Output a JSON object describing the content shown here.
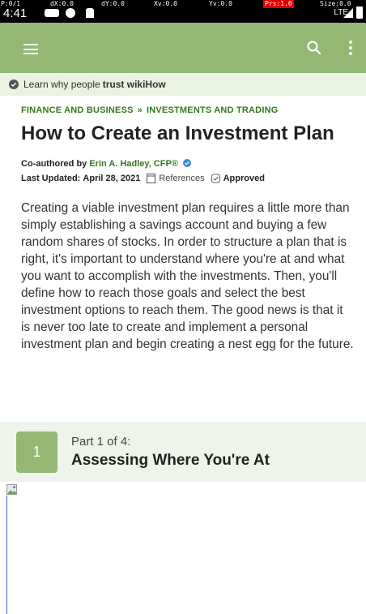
{
  "status_bar": {
    "pointer": {
      "p": "P:0/1",
      "dx": "dX:0.0",
      "dy": "dY:0.0",
      "xv": "Xv:0.0",
      "yv": "Yv:0.0",
      "prs": "Prs:1.0",
      "size": "Size:0.0"
    },
    "time": "4:41",
    "network": "LTE",
    "icons": [
      "notification-icon",
      "cellular-signal-icon",
      "battery-icon"
    ]
  },
  "app_bar": {
    "background": "#93b874",
    "icons": [
      "menu-icon",
      "search-icon",
      "more-vert-icon"
    ]
  },
  "trust_banner": {
    "prefix": "Learn why people",
    "emphasis": "trust wikiHow"
  },
  "breadcrumb": {
    "items": [
      "FINANCE AND BUSINESS",
      "INVESTMENTS AND TRADING"
    ],
    "separator": "»"
  },
  "article": {
    "title": "How to Create an Investment Plan",
    "coauthored_label": "Co-authored by",
    "author": "Erin A. Hadley, CFP®",
    "updated_label": "Last Updated:",
    "updated_date": "April 28, 2021",
    "references_label": "References",
    "approved_label": "Approved",
    "intro": "Creating a viable investment plan requires a little more than simply establishing a savings account and buying a few random shares of stocks. In order to structure a plan that is right, it's important to understand where you're at and what you want to accomplish with the investments. Then, you'll define how to reach those goals and select the best investment options to reach them. The good news is that it is never too late to create and implement a personal investment plan and begin creating a nest egg for the future."
  },
  "part": {
    "number": "1",
    "label": "Part 1 of 4:",
    "title": "Assessing Where You're At"
  },
  "colors": {
    "brand_green": "#93b874",
    "link_green": "#38761d",
    "banner_bg": "#eaf2e0",
    "part_bg": "#eff4ea"
  }
}
